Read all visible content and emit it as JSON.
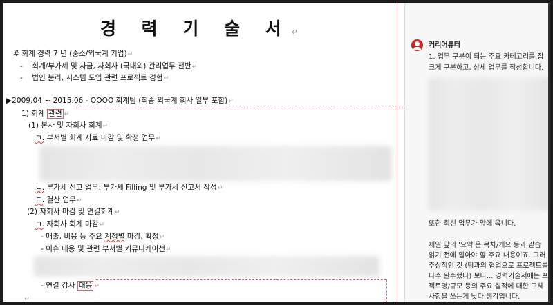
{
  "document": {
    "title": "경 력 기 술 서",
    "summary_heading": "# 회계 경력 7 년 (중소/외국계 기업)",
    "summary_items": [
      "회계/부가세 및 자금, 자회사 (국내외) 관리업무 전반",
      "법인 분리, 시스템 도입 관련 프로젝트 경험"
    ],
    "period_line": "▶2009.04 ~ 2015.06 - OOOO 회계팀 (최종 외국계 회사 일부 포함)",
    "section1_num": "1) 회계 ",
    "section1_highlight": "관련",
    "sub1": "(1) 본사 및 자회사 회계",
    "sub1_a_marker": "ㄱ.",
    "sub1_a_text": "부서별 회계 자료 마감 및 확정 업무",
    "sub1_b_marker": "ㄴ.",
    "sub1_b_text": "부가세 신고 업무: 부가세 Filling 및 부가세 신고서 작성",
    "sub1_c_marker": "ㄷ.",
    "sub1_c_text": "결산 업무",
    "sub2": "(2) 자회사 마감 및 연결회계",
    "sub2_a_marker": "ㄱ.",
    "sub2_a_text": "자회사 회계 마감",
    "sub2_bullet1_pre": "- 매출, 비용 등 주요 ",
    "sub2_bullet1_sq": "계정별",
    "sub2_bullet1_post": " 마감, 확정",
    "sub2_bullet2": "- 이슈 대응 및 관련 부서별 커뮤니케이션",
    "sub2_bullet3_pre": "- 연결 감사 ",
    "sub2_bullet3_highlight": "대응",
    "pilcrow": "↵"
  },
  "comment": {
    "author": "커리어튜터",
    "lines_top": [
      "1. 업무 구분이 되는 주요 카테고리를 잡",
      "크게 구분하고, 상세 업무를 작성합니다."
    ],
    "line_mid": "또한 최신 업무가 앞에 옵니다.",
    "lines_bottom": [
      "제일 앞의 '요약'은 목차/개요 등과 같습",
      "읽기 전에 알아야 할 주요 내용이죠. 그러",
      "추상적인 것 (팀과의 협업으로 프로젝트를",
      "다수 완수했다) 보다... 경력기술서에는 프",
      "젝트명/규모 등의 주요 실적에 대한 구체",
      "사항을 쓰는게 낫다 생각입니다."
    ]
  },
  "colors": {
    "accent_red": "#c62828",
    "markup_line": "#e0556a"
  }
}
